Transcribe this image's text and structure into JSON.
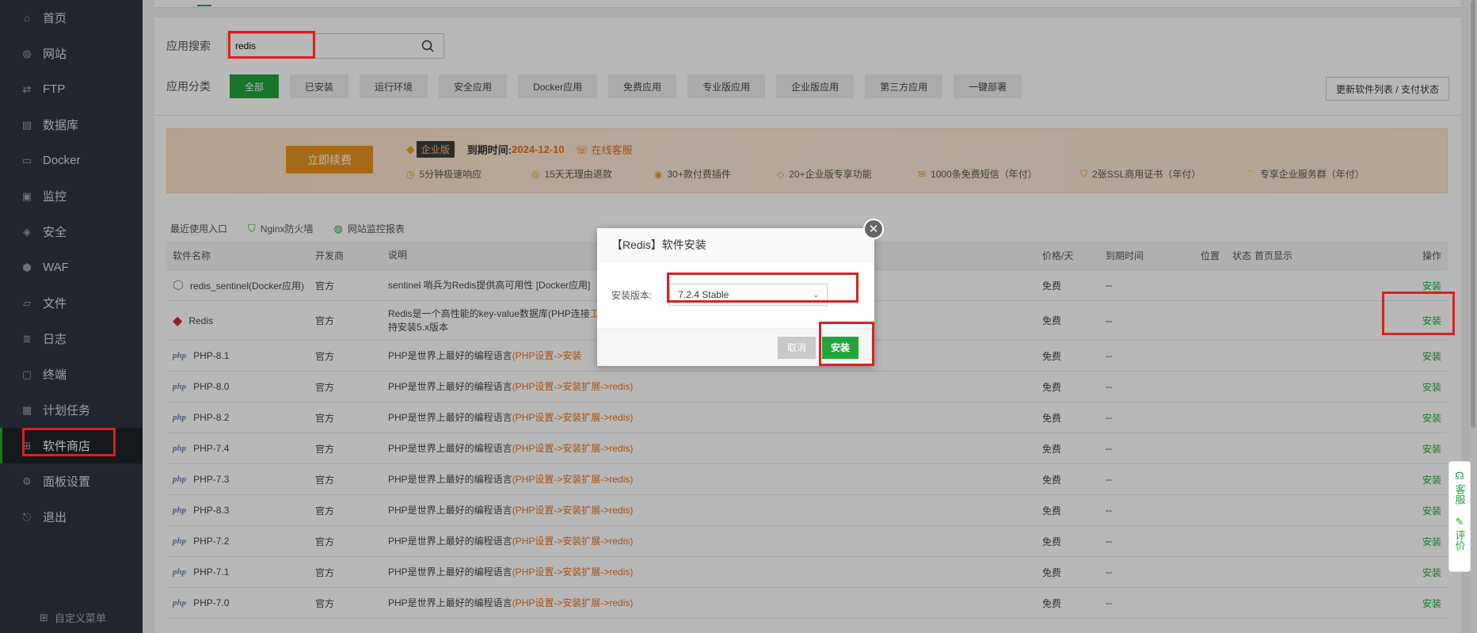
{
  "sidebar": {
    "items": [
      {
        "label": "首页",
        "icon": "home-icon"
      },
      {
        "label": "网站",
        "icon": "globe-icon"
      },
      {
        "label": "FTP",
        "icon": "ftp-icon"
      },
      {
        "label": "数据库",
        "icon": "database-icon"
      },
      {
        "label": "Docker",
        "icon": "docker-icon"
      },
      {
        "label": "监控",
        "icon": "monitor-icon"
      },
      {
        "label": "安全",
        "icon": "shield-icon"
      },
      {
        "label": "WAF",
        "icon": "waf-icon"
      },
      {
        "label": "文件",
        "icon": "folder-icon"
      },
      {
        "label": "日志",
        "icon": "log-icon"
      },
      {
        "label": "终端",
        "icon": "terminal-icon"
      },
      {
        "label": "计划任务",
        "icon": "calendar-icon"
      },
      {
        "label": "软件商店",
        "icon": "grid-icon"
      },
      {
        "label": "面板设置",
        "icon": "gear-icon"
      },
      {
        "label": "退出",
        "icon": "logout-icon"
      }
    ],
    "active_index": 12,
    "custom_menu": "自定义菜单"
  },
  "search": {
    "label": "应用搜索",
    "value": "redis"
  },
  "categories": {
    "label": "应用分类",
    "items": [
      "全部",
      "已安装",
      "运行环境",
      "安全应用",
      "Docker应用",
      "免费应用",
      "专业版应用",
      "企业版应用",
      "第三方应用",
      "一键部署"
    ],
    "active_index": 0,
    "update_button": "更新软件列表 / 支付状态"
  },
  "banner": {
    "renew_button": "立即续费",
    "edition": "企业版",
    "expire_label": "到期时间:",
    "expire_date": "2024-12-10",
    "service": "在线客服",
    "features": [
      "5分钟极速响应",
      "15天无理由退款",
      "30+款付费插件",
      "20+企业版专享功能",
      "1000条免费短信（年付）",
      "2张SSL商用证书（年付）",
      "专享企业服务群（年付）"
    ]
  },
  "quick": {
    "label": "最近使用入口",
    "items": [
      "Nginx防火墙",
      "网站监控报表"
    ]
  },
  "table": {
    "headers": {
      "name": "软件名称",
      "dev": "开发商",
      "desc": "说明",
      "price": "价格/天",
      "expire": "到期时间",
      "position": "位置",
      "state": "状态",
      "home": "首页显示",
      "op": "操作"
    },
    "rows": [
      {
        "name": "redis_sentinel(Docker应用)",
        "dev": "官方",
        "desc": "sentinel 哨兵为Redis提供高可用性 [Docker应用]",
        "link": "",
        "price": "免费",
        "expire": "--",
        "op": "安装"
      },
      {
        "name": "Redis",
        "dev": "官方",
        "desc": "Redis是一个高性能的key-value数据库(PHP连接",
        "desc2": "持安装5.x版本",
        "link": "工具请前往：左侧菜单->数据库->redis",
        "price": "免费",
        "expire": "--",
        "op": "安装"
      },
      {
        "name": "PHP-8.1",
        "dev": "官方",
        "desc": "PHP是世界上最好的编程语言",
        "link": "(PHP设置->安装",
        "price": "免费",
        "expire": "--",
        "op": "安装"
      },
      {
        "name": "PHP-8.0",
        "dev": "官方",
        "desc": "PHP是世界上最好的编程语言",
        "link": "(PHP设置->安装扩展->redis)",
        "price": "免费",
        "expire": "--",
        "op": "安装"
      },
      {
        "name": "PHP-8.2",
        "dev": "官方",
        "desc": "PHP是世界上最好的编程语言",
        "link": "(PHP设置->安装扩展->redis)",
        "price": "免费",
        "expire": "--",
        "op": "安装"
      },
      {
        "name": "PHP-7.4",
        "dev": "官方",
        "desc": "PHP是世界上最好的编程语言",
        "link": "(PHP设置->安装扩展->redis)",
        "price": "免费",
        "expire": "--",
        "op": "安装"
      },
      {
        "name": "PHP-7.3",
        "dev": "官方",
        "desc": "PHP是世界上最好的编程语言",
        "link": "(PHP设置->安装扩展->redis)",
        "price": "免费",
        "expire": "--",
        "op": "安装"
      },
      {
        "name": "PHP-8.3",
        "dev": "官方",
        "desc": "PHP是世界上最好的编程语言",
        "link": "(PHP设置->安装扩展->redis)",
        "price": "免费",
        "expire": "--",
        "op": "安装"
      },
      {
        "name": "PHP-7.2",
        "dev": "官方",
        "desc": "PHP是世界上最好的编程语言",
        "link": "(PHP设置->安装扩展->redis)",
        "price": "免费",
        "expire": "--",
        "op": "安装"
      },
      {
        "name": "PHP-7.1",
        "dev": "官方",
        "desc": "PHP是世界上最好的编程语言",
        "link": "(PHP设置->安装扩展->redis)",
        "price": "免费",
        "expire": "--",
        "op": "安装"
      },
      {
        "name": "PHP-7.0",
        "dev": "官方",
        "desc": "PHP是世界上最好的编程语言",
        "link": "(PHP设置->安装扩展->redis)",
        "price": "免费",
        "expire": "--",
        "op": "安装"
      }
    ]
  },
  "modal": {
    "title": "【Redis】软件安装",
    "version_label": "安装版本:",
    "version_value": "7.2.4 Stable",
    "cancel": "取消",
    "install": "安装"
  },
  "float_tools": {
    "service": "客服",
    "review": "评价"
  },
  "colors": {
    "accent": "#20a53a",
    "sidebar_bg": "#2e3440",
    "highlight": "#d9201f",
    "warning": "#e6701a"
  }
}
